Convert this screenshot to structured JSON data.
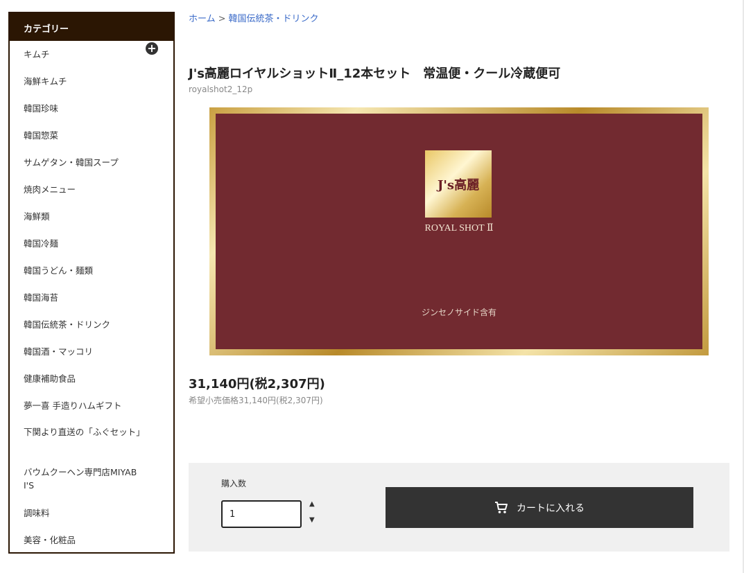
{
  "sidebar": {
    "header": "カテゴリー",
    "items": [
      {
        "label": "キムチ",
        "has_expand": true
      },
      {
        "label": "海鮮キムチ"
      },
      {
        "label": "韓国珍味"
      },
      {
        "label": "韓国惣菜"
      },
      {
        "label": "サムゲタン・韓国スープ"
      },
      {
        "label": "焼肉メニュー"
      },
      {
        "label": "海鮮類"
      },
      {
        "label": "韓国冷麺"
      },
      {
        "label": "韓国うどん・麺類"
      },
      {
        "label": "韓国海苔"
      },
      {
        "label": "韓国伝統茶・ドリンク"
      },
      {
        "label": "韓国酒・マッコリ"
      },
      {
        "label": "健康補助食品"
      },
      {
        "label": "夢一喜 手造りハムギフト"
      },
      {
        "label": "下関より直送の「ふぐセット」"
      },
      {
        "label": "バウムクーヘン専門店MIYABI'S"
      },
      {
        "label": "調味料"
      },
      {
        "label": "美容・化粧品"
      }
    ]
  },
  "breadcrumb": {
    "home": "ホーム",
    "separator": ">",
    "current": "韓国伝統茶・ドリンク"
  },
  "product": {
    "title": "J's高麗ロイヤルショットⅡ_12本セット　常温便・クール冷蔵便可",
    "code": "royalshot2_12p",
    "image": {
      "logo": "J's高麗",
      "subtitle": "ROYAL SHOT Ⅱ",
      "caption": "ジンセノサイド含有"
    },
    "price": "31,140円(税2,307円)",
    "list_price": "希望小売価格31,140円(税2,307円)"
  },
  "purchase": {
    "quantity_label": "購入数",
    "quantity_value": "1",
    "cart_button_label": "カートに入れる",
    "stepper_up": "▲",
    "stepper_down": "▼"
  }
}
